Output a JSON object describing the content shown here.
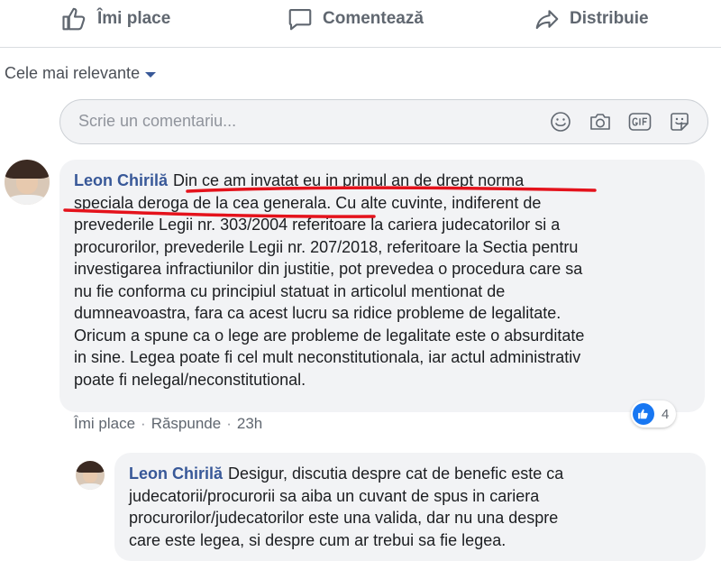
{
  "actions": {
    "like": "Îmi place",
    "comment": "Comentează",
    "share": "Distribuie"
  },
  "sort": {
    "label": "Cele mai relevante"
  },
  "composer": {
    "placeholder": "Scrie un comentariu..."
  },
  "comment": {
    "author": "Leon Chirilă",
    "lines": [
      "Din ce am invatat eu in primul an de drept norma",
      "speciala deroga de la cea generala. Cu alte cuvinte, indiferent de",
      "prevederile Legii nr. 303/2004 referitoare la cariera judecatorilor si a",
      "procurorilor, prevederile Legii nr. 207/2018, referitoare la Sectia pentru",
      "investigarea infractiunilor din justitie, pot prevedea o procedura care sa",
      "nu fie conforma cu principiul statuat in articolul mentionat de",
      "dumneavoastra, fara ca acest lucru sa ridice probleme de legalitate.",
      "Oricum a spune ca o lege are probleme de legalitate este o absurditate",
      "in sine. Legea poate fi cel mult neconstitutionala, iar actul administrativ",
      "poate fi nelegal/neconstitutional."
    ],
    "like_label": "Îmi place",
    "reply_label": "Răspunde",
    "separator": "·",
    "time": "23h",
    "reaction_count": "4"
  },
  "reply": {
    "author": "Leon Chirilă",
    "lines": [
      "Desigur, discutia despre cat de benefic este ca",
      "judecatorii/procurorii sa aiba un cuvant de spus in cariera",
      "procurorilor/judecatorilor este una valida, dar nu una despre",
      "care este legea, si despre cum ar trebui sa fie legea."
    ]
  },
  "colors": {
    "author": "#385898",
    "underline": "#e4121b",
    "like_badge": "#1877f2"
  }
}
